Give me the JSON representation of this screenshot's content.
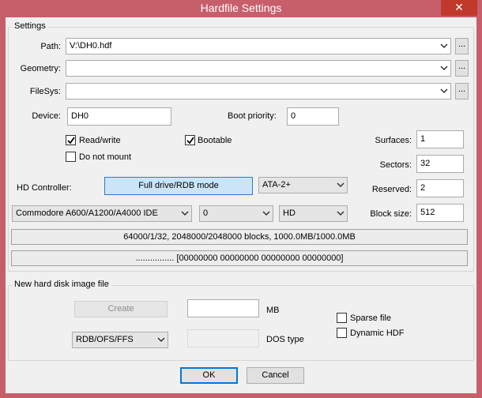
{
  "window": {
    "title": "Hardfile Settings",
    "close_glyph": "✕"
  },
  "settings": {
    "group_title": "Settings",
    "path_label": "Path:",
    "path_value": "V:\\DH0.hdf",
    "geometry_label": "Geometry:",
    "geometry_value": "",
    "filesys_label": "FileSys:",
    "filesys_value": "",
    "browse_label": "...",
    "device_label": "Device:",
    "device_value": "DH0",
    "boot_priority_label": "Boot priority:",
    "boot_priority_value": "0",
    "readwrite_label": "Read/write",
    "readwrite_checked": true,
    "bootable_label": "Bootable",
    "bootable_checked": true,
    "donotmount_label": "Do not mount",
    "donotmount_checked": false,
    "surfaces_label": "Surfaces:",
    "surfaces_value": "1",
    "sectors_label": "Sectors:",
    "sectors_value": "32",
    "reserved_label": "Reserved:",
    "reserved_value": "2",
    "blocksize_label": "Block size:",
    "blocksize_value": "512",
    "hd_controller_label": "HD Controller:",
    "rdb_mode_button": "Full drive/RDB mode",
    "ata_select": "ATA-2+",
    "controller_select": "Commodore A600/A1200/A4000 IDE",
    "unit_select": "0",
    "type_select": "HD",
    "geometry_info": "64000/1/32, 2048000/2048000 blocks, 1000.0MB/1000.0MB",
    "block_info": "................ [00000000 00000000 00000000 00000000]"
  },
  "new_image": {
    "group_title": "New hard disk image file",
    "create_button": "Create",
    "size_value": "",
    "size_unit": "MB",
    "fs_select": "RDB/OFS/FFS",
    "dostype_value": "",
    "dostype_label": "DOS type",
    "sparse_label": "Sparse file",
    "sparse_checked": false,
    "dynamic_label": "Dynamic HDF",
    "dynamic_checked": false
  },
  "footer": {
    "ok_button": "OK",
    "cancel_button": "Cancel"
  },
  "icons": {
    "check": "checkmark-icon",
    "dropdown": "chevron-down-icon"
  }
}
